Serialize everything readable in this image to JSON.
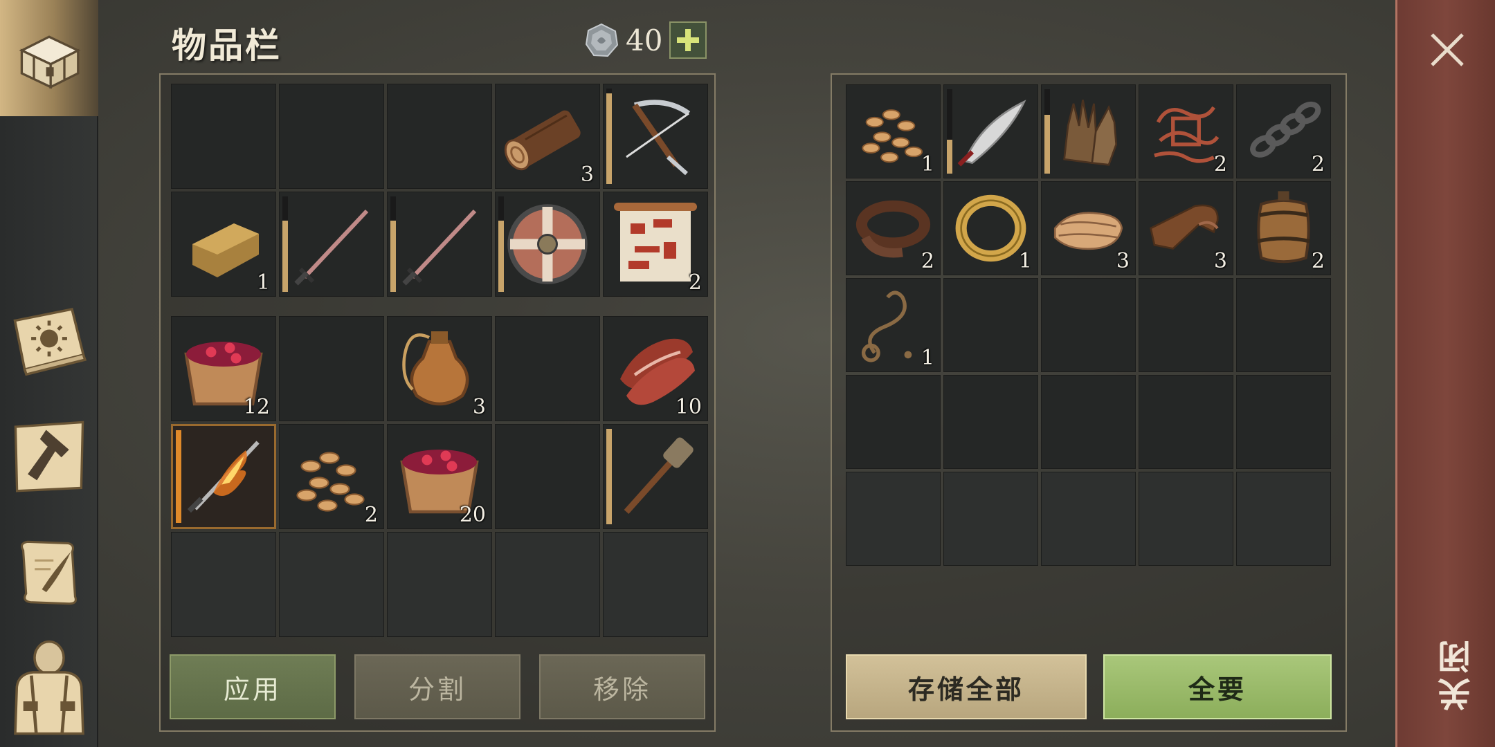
{
  "header": {
    "title": "物品栏",
    "currency": "40"
  },
  "inventory": {
    "rows": [
      [
        {
          "item": null
        },
        {
          "item": null
        },
        {
          "item": null
        },
        {
          "item": "log-icon",
          "qty": "3"
        },
        {
          "item": "crossbow-icon",
          "durability": 0.95
        }
      ],
      [
        {
          "item": "clay-ingot-icon",
          "qty": "1"
        },
        {
          "item": "sword-icon",
          "durability": 0.75
        },
        {
          "item": "sword-icon",
          "durability": 0.75
        },
        {
          "item": "round-shield-icon",
          "durability": 0.75
        },
        {
          "item": "recipe-scroll-icon",
          "qty": "2"
        }
      ],
      [
        {
          "item": "berry-bowl-icon",
          "qty": "12"
        },
        {
          "item": null
        },
        {
          "item": "water-flask-icon",
          "qty": "3"
        },
        {
          "item": null
        },
        {
          "item": "raw-meat-icon",
          "qty": "10"
        }
      ],
      [
        {
          "item": "flame-sword-icon",
          "durability": 1.0,
          "selected": true
        },
        {
          "item": "seeds-icon",
          "qty": "2"
        },
        {
          "item": "berry-bowl-icon",
          "qty": "20"
        },
        {
          "item": null
        },
        {
          "item": "torch-club-icon",
          "durability": 1.0
        }
      ],
      [
        {
          "item": null,
          "locked": true
        },
        {
          "item": null,
          "locked": true
        },
        {
          "item": null,
          "locked": true
        },
        {
          "item": null,
          "locked": true
        },
        {
          "item": null,
          "locked": true
        }
      ]
    ]
  },
  "storage": {
    "rows": [
      [
        {
          "item": "seeds-icon",
          "qty": "1"
        },
        {
          "item": "scimitar-icon",
          "durability": 0.4
        },
        {
          "item": "leather-gloves-icon",
          "durability": 0.7
        },
        {
          "item": "rope-knot-icon",
          "qty": "2"
        },
        {
          "item": "chain-icon",
          "qty": "2"
        }
      ],
      [
        {
          "item": "leather-strap-icon",
          "qty": "2"
        },
        {
          "item": "gold-ring-icon",
          "qty": "1"
        },
        {
          "item": "cloth-icon",
          "qty": "3"
        },
        {
          "item": "leather-icon",
          "qty": "3"
        },
        {
          "item": "barrel-icon",
          "qty": "2"
        }
      ],
      [
        {
          "item": "rope-icon",
          "qty": "1"
        },
        {
          "item": null
        },
        {
          "item": null
        },
        {
          "item": null
        },
        {
          "item": null
        }
      ],
      [
        {
          "item": null
        },
        {
          "item": null
        },
        {
          "item": null
        },
        {
          "item": null
        },
        {
          "item": null
        }
      ],
      [
        {
          "item": null,
          "locked": true
        },
        {
          "item": null,
          "locked": true
        },
        {
          "item": null,
          "locked": true
        },
        {
          "item": null,
          "locked": true
        },
        {
          "item": null,
          "locked": true
        }
      ]
    ]
  },
  "buttons": {
    "apply": "应用",
    "split": "分割",
    "remove": "移除",
    "store_all": "存储全部",
    "take_all": "全要",
    "close": "关闭"
  },
  "sidebar": {
    "items": [
      {
        "icon": "chest-icon",
        "active": true
      },
      {
        "icon": "sun-book-icon"
      },
      {
        "icon": "crafting-hammer-icon"
      },
      {
        "icon": "scroll-quill-icon"
      },
      {
        "icon": "character-backpack-icon"
      }
    ]
  }
}
